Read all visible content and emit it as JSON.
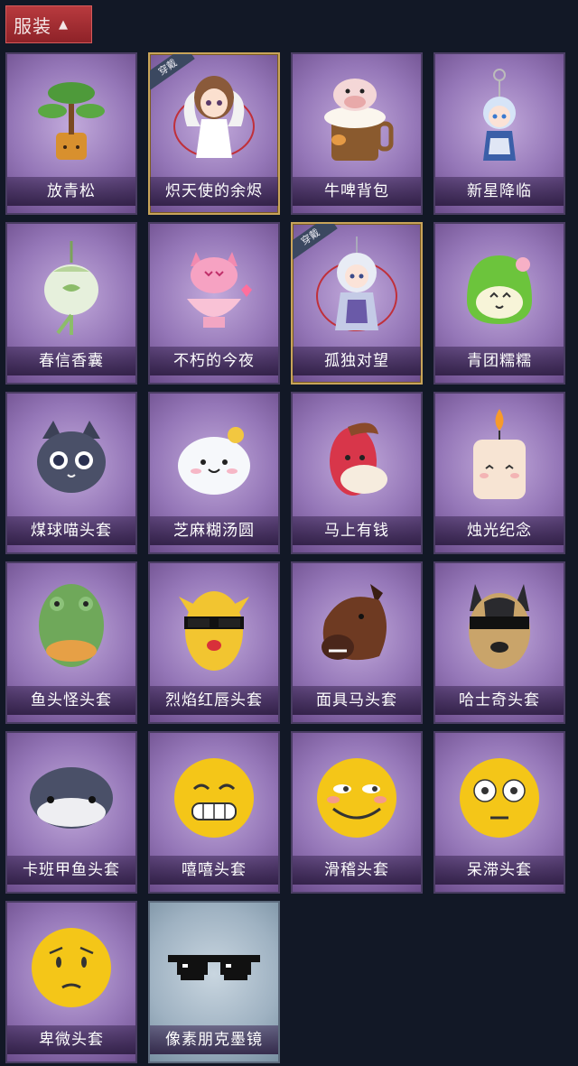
{
  "header": {
    "tab_label": "服装"
  },
  "items": [
    {
      "label": "放青松",
      "icon": "bonsai-plant-icon",
      "equipped": false
    },
    {
      "label": "炽天使的余烬",
      "icon": "angel-doll-icon",
      "equipped": true,
      "equipped_label": "穿戴"
    },
    {
      "label": "牛啤背包",
      "icon": "cow-beer-mug-icon",
      "equipped": false
    },
    {
      "label": "新星降临",
      "icon": "star-keychain-icon",
      "equipped": false
    },
    {
      "label": "春信香囊",
      "icon": "sachet-icon",
      "equipped": false
    },
    {
      "label": "不朽的今夜",
      "icon": "pink-fox-icon",
      "equipped": false
    },
    {
      "label": "孤独对望",
      "icon": "silver-doll-icon",
      "equipped": true,
      "equipped_label": "穿戴"
    },
    {
      "label": "青团糯糯",
      "icon": "green-rice-cake-icon",
      "equipped": false
    },
    {
      "label": "煤球喵头套",
      "icon": "black-cat-head-icon",
      "equipped": false
    },
    {
      "label": "芝麻糊汤圆",
      "icon": "white-dumpling-icon",
      "equipped": false
    },
    {
      "label": "马上有钱",
      "icon": "red-horse-head-icon",
      "equipped": false
    },
    {
      "label": "烛光纪念",
      "icon": "candle-icon",
      "equipped": false
    },
    {
      "label": "鱼头怪头套",
      "icon": "fish-head-mask-icon",
      "equipped": false
    },
    {
      "label": "烈焰红唇头套",
      "icon": "yellow-lips-mask-icon",
      "equipped": false
    },
    {
      "label": "面具马头套",
      "icon": "horse-mask-icon",
      "equipped": false
    },
    {
      "label": "哈士奇头套",
      "icon": "husky-mask-icon",
      "equipped": false
    },
    {
      "label": "卡班甲鱼头套",
      "icon": "fish-helmet-icon",
      "equipped": false
    },
    {
      "label": "嘻嘻头套",
      "icon": "grin-emoji-mask-icon",
      "equipped": false
    },
    {
      "label": "滑稽头套",
      "icon": "smirk-emoji-mask-icon",
      "equipped": false
    },
    {
      "label": "呆滞头套",
      "icon": "stare-emoji-mask-icon",
      "equipped": false
    },
    {
      "label": "卑微头套",
      "icon": "humble-emoji-mask-icon",
      "equipped": false
    },
    {
      "label": "像素朋克墨镜",
      "icon": "pixel-sunglasses-icon",
      "equipped": false
    }
  ],
  "colors": {
    "background": "#121826",
    "tab_red": "#a8303a",
    "card_purple": "#9577b8",
    "selected_gold": "#c8a45a"
  }
}
